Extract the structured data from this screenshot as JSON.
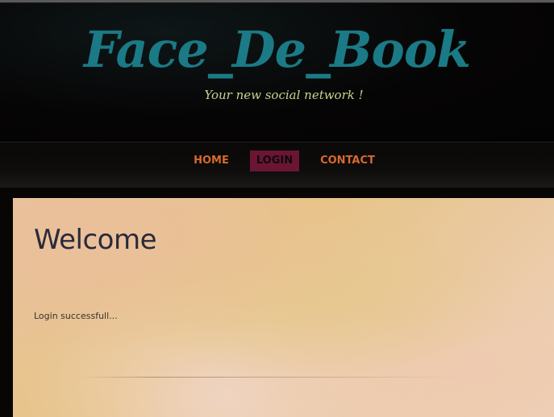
{
  "header": {
    "title": "Face_De_Book",
    "tagline": "Your new social network !"
  },
  "nav": {
    "items": [
      {
        "label": "HOME"
      },
      {
        "label": "LOGIN",
        "active": true
      },
      {
        "label": "CONTACT"
      }
    ]
  },
  "main": {
    "heading": "Welcome",
    "message": "Login successfull..."
  },
  "colors": {
    "title": "#1a7a85",
    "tagline": "#c4d48e",
    "nav_link": "#d7692e",
    "nav_active_bg": "#6b1535",
    "heading": "#2a2a3a",
    "background": "#070605"
  }
}
